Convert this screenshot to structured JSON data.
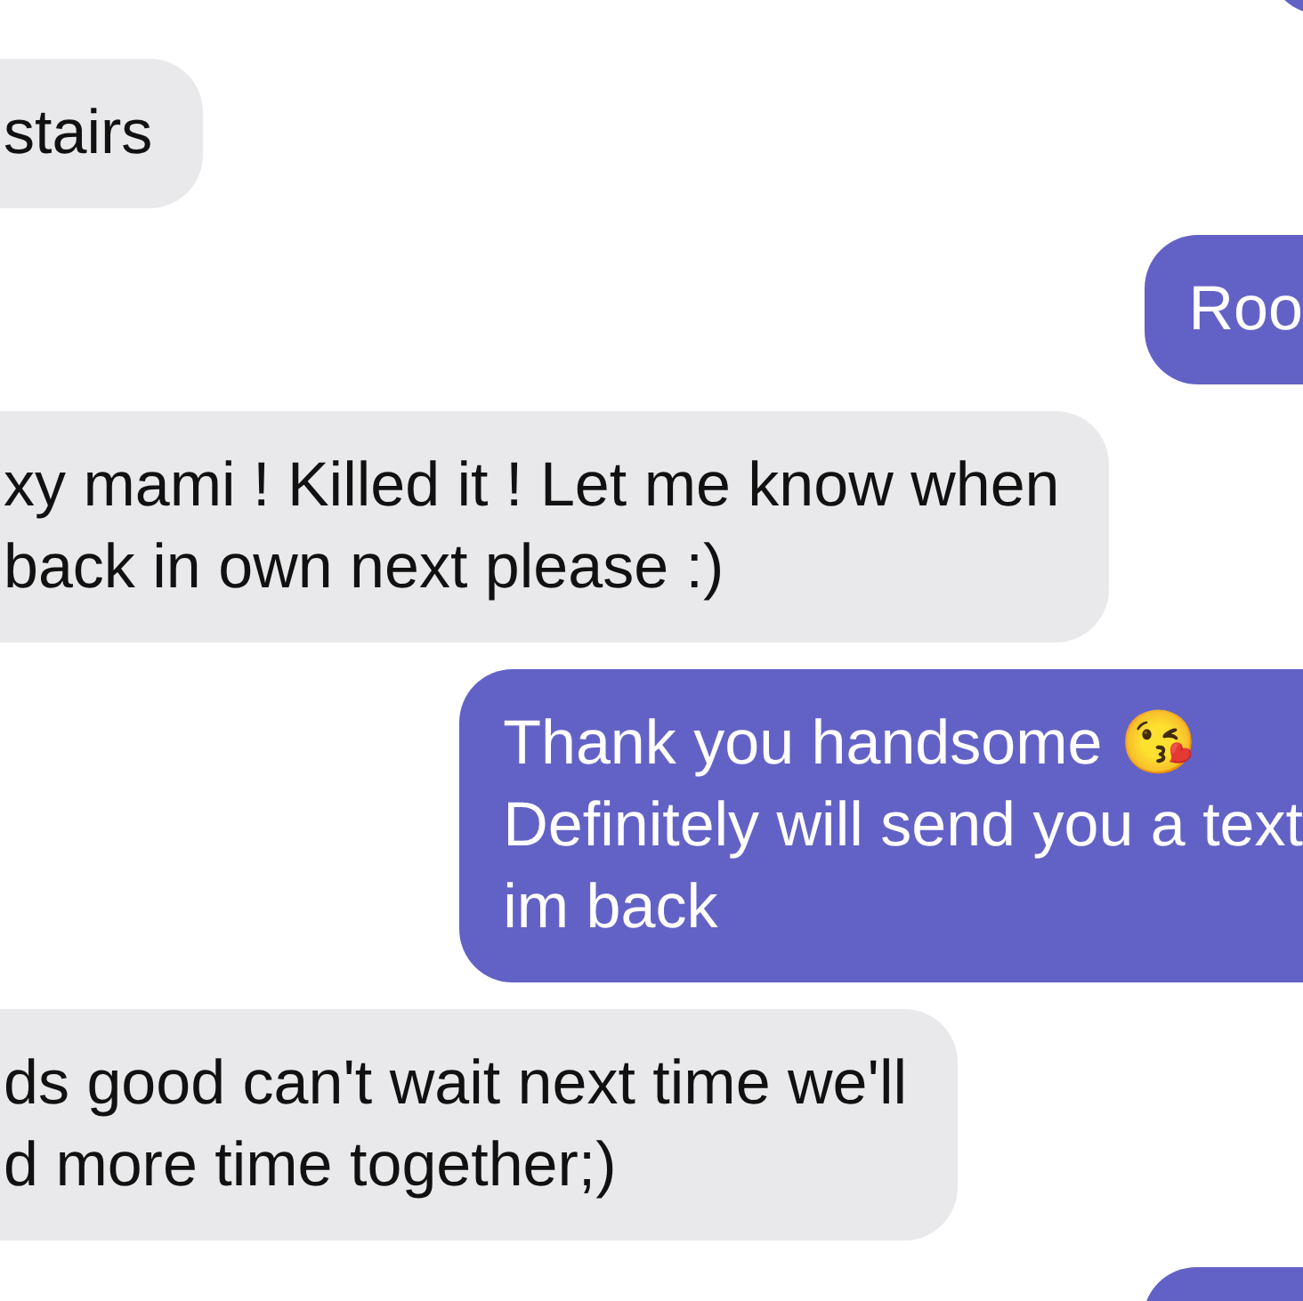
{
  "messages": [
    {
      "kind": "outgoing"
    },
    {
      "kind": "incoming",
      "text": "stairs"
    },
    {
      "kind": "outgoing",
      "text": "Roo"
    },
    {
      "kind": "incoming",
      "text": "xy mami ! Killed it ! Let me know when\nback in own next please :)"
    },
    {
      "kind": "outgoing",
      "text": "Thank you handsome 😘\nDefinitely will send you a text\nim back"
    },
    {
      "kind": "incoming",
      "text": "ds good can't wait next time we'll\nd more time together;)"
    },
    {
      "kind": "outgoing"
    }
  ]
}
